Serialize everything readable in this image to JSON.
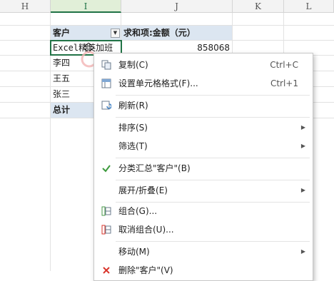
{
  "columns": [
    "H",
    "I",
    "J",
    "K",
    "L"
  ],
  "pivot": {
    "header_field": "客户",
    "header_value": "求和项:金额（元）",
    "rows": [
      {
        "name": "Excel精英加班",
        "value": "858068"
      },
      {
        "name": "李四",
        "value": ""
      },
      {
        "name": "王五",
        "value": ""
      },
      {
        "name": "张三",
        "value": ""
      }
    ],
    "total_label": "总计"
  },
  "menu": {
    "copy": {
      "label": "复制(C)",
      "shortcut": "Ctrl+C"
    },
    "format": {
      "label": "设置单元格格式(F)...",
      "shortcut": "Ctrl+1"
    },
    "refresh": {
      "label": "刷新(R)"
    },
    "sort": {
      "label": "排序(S)"
    },
    "filter": {
      "label": "筛选(T)"
    },
    "subtotal": {
      "label": "分类汇总\"客户\"(B)"
    },
    "expand": {
      "label": "展开/折叠(E)"
    },
    "group": {
      "label": "组合(G)..."
    },
    "ungroup": {
      "label": "取消组合(U)..."
    },
    "move": {
      "label": "移动(M)"
    },
    "delete": {
      "label": "删除\"客户\"(V)"
    }
  },
  "colors": {
    "accent": "#217346",
    "pivot_header": "#dce6f1",
    "check": "#3c9a3c",
    "delete": "#d9342b"
  }
}
